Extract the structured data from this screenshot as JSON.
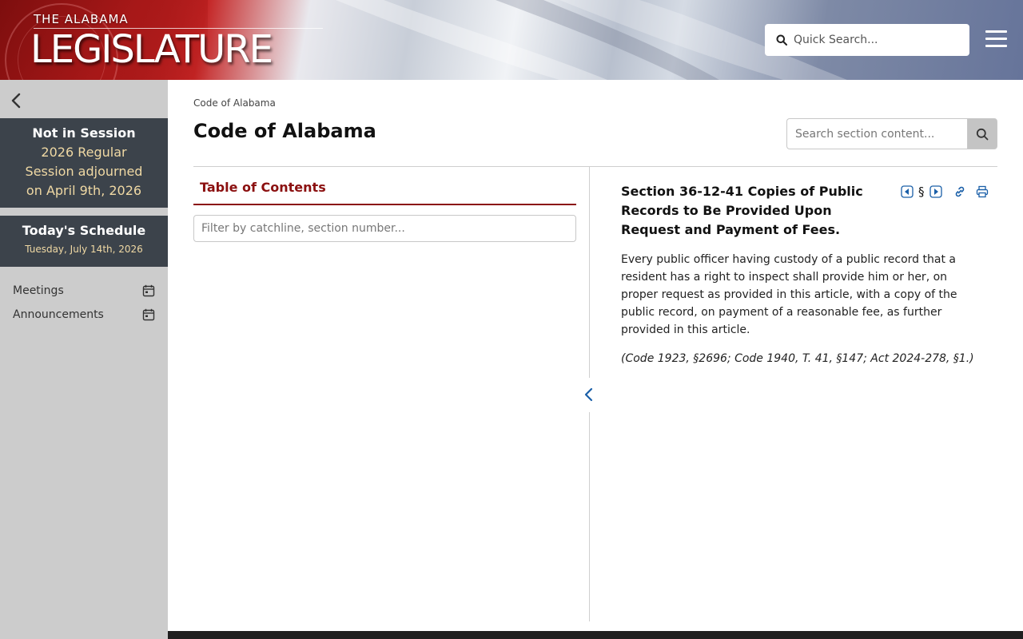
{
  "header": {
    "logo_top": "THE ALABAMA",
    "logo_main": "LEGISLATURE",
    "quick_search_placeholder": "Quick Search...",
    "icons": {
      "search": "search-icon",
      "menu": "hamburger-menu-icon"
    }
  },
  "sidebar": {
    "session_status": "Not in Session",
    "session_detail": "2026 Regular Session adjourned on April 9th, 2026",
    "schedule_title": "Today's Schedule",
    "schedule_date": "Tuesday, July 14th, 2026",
    "links": [
      {
        "label": "Meetings",
        "icon": "calendar-icon"
      },
      {
        "label": "Announcements",
        "icon": "calendar-icon"
      }
    ]
  },
  "main": {
    "breadcrumb": "Code of Alabama",
    "title": "Code of Alabama",
    "section_search_placeholder": "Search section content...",
    "toc_tab": "Table of Contents",
    "toc_filter_placeholder": "Filter by catchline, section number...",
    "section": {
      "heading": "Section 36-12-41 Copies of Public Records to Be Provided Upon Request and Payment of Fees.",
      "symbol": "§",
      "body": "Every public officer having custody of a public record that a resident has a right to inspect shall provide him or her, on proper request as provided in this article, with a copy of the public record, on payment of a reasonable fee, as further provided in this article.",
      "history": "(Code 1923, §2696; Code 1940, T. 41, §147; Act 2024-278, §1.)"
    }
  },
  "colors": {
    "accent_red": "#8b1010",
    "sidebar_bg": "#cccccc",
    "panel_dark": "#3c434b",
    "gold_text": "#f0d9a4",
    "icon_blue": "#1a5fa8"
  }
}
